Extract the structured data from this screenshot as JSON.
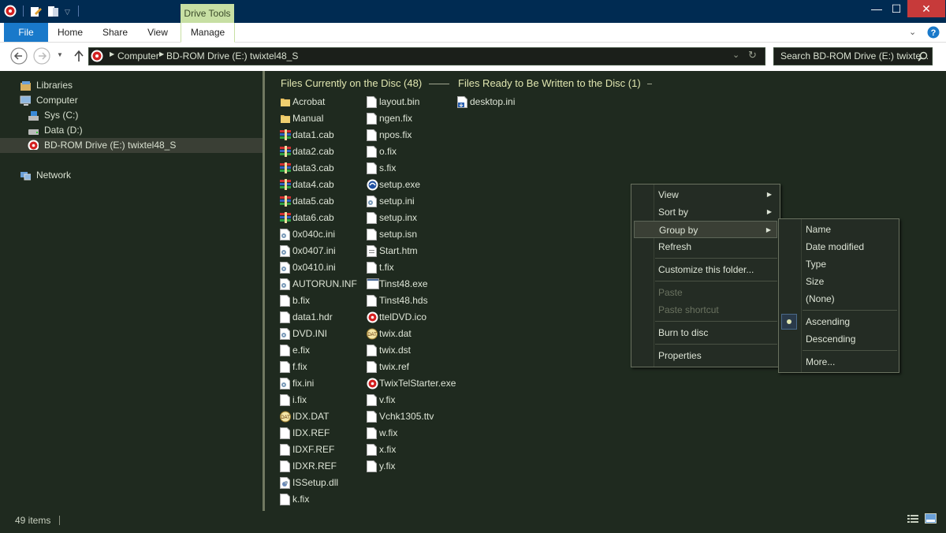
{
  "ribbon": {
    "contextual_group": "Drive Tools",
    "tabs": {
      "file": "File",
      "home": "Home",
      "share": "Share",
      "view": "View",
      "manage": "Manage"
    }
  },
  "window": {
    "minimize": "—",
    "maximize": "☐",
    "close": "✕"
  },
  "address": {
    "computer": "Computer",
    "drive": "BD-ROM Drive (E:) twixtel48_S"
  },
  "search": {
    "placeholder": "Search BD-ROM Drive (E:) twixte..."
  },
  "nav": {
    "libraries": "Libraries",
    "computer": "Computer",
    "sys": "Sys (C:)",
    "data": "Data (D:)",
    "bd": "BD-ROM Drive (E:) twixtel48_S",
    "network": "Network"
  },
  "groups": {
    "on_disc": "Files Currently on the Disc (48)",
    "ready": "Files Ready to Be Written to the Disc (1)"
  },
  "files_col1": [
    {
      "name": "Acrobat",
      "icon": "folder-icon"
    },
    {
      "name": "Manual",
      "icon": "folder-icon"
    },
    {
      "name": "data1.cab",
      "icon": "cab-icon"
    },
    {
      "name": "data2.cab",
      "icon": "cab-icon"
    },
    {
      "name": "data3.cab",
      "icon": "cab-icon"
    },
    {
      "name": "data4.cab",
      "icon": "cab-icon"
    },
    {
      "name": "data5.cab",
      "icon": "cab-icon"
    },
    {
      "name": "data6.cab",
      "icon": "cab-icon"
    },
    {
      "name": "0x040c.ini",
      "icon": "ini-icon"
    },
    {
      "name": "0x0407.ini",
      "icon": "ini-icon"
    },
    {
      "name": "0x0410.ini",
      "icon": "ini-icon"
    },
    {
      "name": "AUTORUN.INF",
      "icon": "ini-icon"
    },
    {
      "name": "b.fix",
      "icon": "file-icon"
    },
    {
      "name": "data1.hdr",
      "icon": "file-icon"
    },
    {
      "name": "DVD.INI",
      "icon": "ini-icon"
    },
    {
      "name": "e.fix",
      "icon": "file-icon"
    },
    {
      "name": "f.fix",
      "icon": "file-icon"
    },
    {
      "name": "fix.ini",
      "icon": "ini-icon"
    },
    {
      "name": "i.fix",
      "icon": "file-icon"
    },
    {
      "name": "IDX.DAT",
      "icon": "dat-icon"
    },
    {
      "name": "IDX.REF",
      "icon": "file-icon"
    },
    {
      "name": "IDXF.REF",
      "icon": "file-icon"
    },
    {
      "name": "IDXR.REF",
      "icon": "file-icon"
    },
    {
      "name": "ISSetup.dll",
      "icon": "dll-icon"
    },
    {
      "name": "k.fix",
      "icon": "file-icon"
    }
  ],
  "files_col2": [
    {
      "name": "layout.bin",
      "icon": "file-icon"
    },
    {
      "name": "ngen.fix",
      "icon": "file-icon"
    },
    {
      "name": "npos.fix",
      "icon": "file-icon"
    },
    {
      "name": "o.fix",
      "icon": "file-icon"
    },
    {
      "name": "s.fix",
      "icon": "file-icon"
    },
    {
      "name": "setup.exe",
      "icon": "setup-exe-icon"
    },
    {
      "name": "setup.ini",
      "icon": "ini-icon"
    },
    {
      "name": "setup.inx",
      "icon": "file-icon"
    },
    {
      "name": "setup.isn",
      "icon": "file-icon"
    },
    {
      "name": "Start.htm",
      "icon": "htm-icon"
    },
    {
      "name": "t.fix",
      "icon": "file-icon"
    },
    {
      "name": "Tinst48.exe",
      "icon": "exe-icon"
    },
    {
      "name": "Tinst48.hds",
      "icon": "file-icon"
    },
    {
      "name": "ttelDVD.ico",
      "icon": "disc-icon"
    },
    {
      "name": "twix.dat",
      "icon": "dat-icon"
    },
    {
      "name": "twix.dst",
      "icon": "file-icon"
    },
    {
      "name": "twix.ref",
      "icon": "file-icon"
    },
    {
      "name": "TwixTelStarter.exe",
      "icon": "disc-icon"
    },
    {
      "name": "v.fix",
      "icon": "file-icon"
    },
    {
      "name": "Vchk1305.ttv",
      "icon": "file-icon"
    },
    {
      "name": "w.fix",
      "icon": "file-icon"
    },
    {
      "name": "x.fix",
      "icon": "file-icon"
    },
    {
      "name": "y.fix",
      "icon": "file-icon"
    }
  ],
  "files_ready": [
    {
      "name": "desktop.ini",
      "icon": "pending-ini-icon"
    }
  ],
  "context_menu": {
    "view": "View",
    "sort_by": "Sort by",
    "group_by": "Group by",
    "refresh": "Refresh",
    "customize": "Customize this folder...",
    "paste": "Paste",
    "paste_shortcut": "Paste shortcut",
    "burn": "Burn to disc",
    "properties": "Properties"
  },
  "group_submenu": {
    "name": "Name",
    "date_modified": "Date modified",
    "type": "Type",
    "size": "Size",
    "none": "(None)",
    "ascending": "Ascending",
    "descending": "Descending",
    "more": "More..."
  },
  "status": {
    "items": "49 items"
  },
  "colors": {
    "accent": "#1979ca",
    "background": "#1f2a1f",
    "group_header": "#e0e6b0",
    "drive_tools": "#c7dfa3"
  }
}
